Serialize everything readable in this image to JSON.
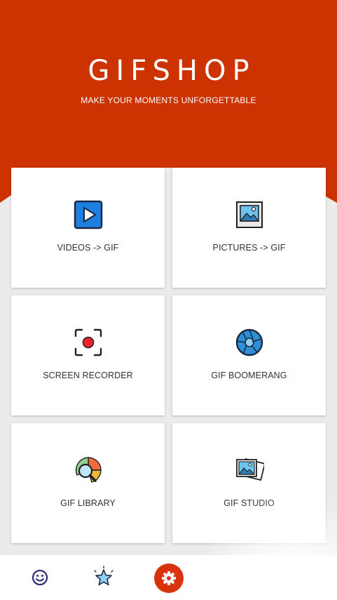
{
  "colors": {
    "primary": "#cc3300",
    "background": "#ebebeb",
    "card": "#ffffff",
    "accent_button": "#d9320d",
    "icon_blue": "#1f7fe0",
    "label_text": "#333333"
  },
  "header": {
    "title": "GIFSHOP",
    "subtitle": "MAKE YOUR MOMENTS UNFORGETTABLE"
  },
  "features": [
    {
      "label": "VIDEOS -> GIF",
      "icon": "play-video-icon"
    },
    {
      "label": "PICTURES -> GIF",
      "icon": "picture-icon"
    },
    {
      "label": "SCREEN RECORDER",
      "icon": "record-icon"
    },
    {
      "label": "GIF BOOMERANG",
      "icon": "aperture-icon"
    },
    {
      "label": "GIF LIBRARY",
      "icon": "library-search-icon"
    },
    {
      "label": "GIF STUDIO",
      "icon": "photos-icon"
    }
  ],
  "bottom_nav": [
    {
      "icon": "smiley-icon"
    },
    {
      "icon": "star-icon"
    },
    {
      "icon": "gear-icon"
    }
  ]
}
